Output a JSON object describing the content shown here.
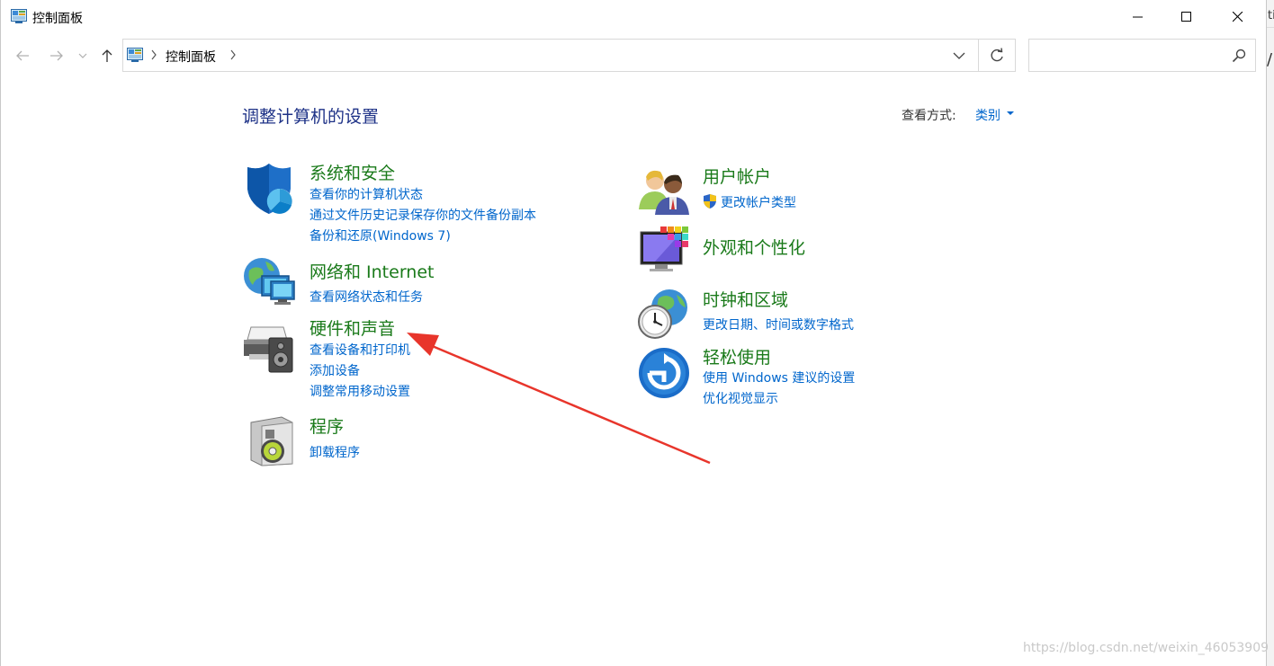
{
  "window": {
    "title": "控制面板"
  },
  "address_bar": {
    "breadcrumb": "控制面板",
    "separator": "›"
  },
  "search": {
    "value": "",
    "placeholder": ""
  },
  "main": {
    "heading": "调整计算机的设置",
    "view_by_label": "查看方式:",
    "view_by_value": "类别"
  },
  "categories": {
    "system_security": {
      "title": "系统和安全",
      "links": [
        "查看你的计算机状态",
        "通过文件历史记录保存你的文件备份副本",
        "备份和还原(Windows 7)"
      ]
    },
    "network": {
      "title": "网络和 Internet",
      "links": [
        "查看网络状态和任务"
      ]
    },
    "hardware": {
      "title": "硬件和声音",
      "links": [
        "查看设备和打印机",
        "添加设备",
        "调整常用移动设置"
      ]
    },
    "programs": {
      "title": "程序",
      "links": [
        "卸载程序"
      ]
    },
    "user_accounts": {
      "title": "用户帐户",
      "links": [
        "更改帐户类型"
      ]
    },
    "appearance": {
      "title": "外观和个性化",
      "links": []
    },
    "clock_region": {
      "title": "时钟和区域",
      "links": [
        "更改日期、时间或数字格式"
      ]
    },
    "ease_of_access": {
      "title": "轻松使用",
      "links": [
        "使用 Windows 建议的设置",
        "优化视觉显示"
      ]
    }
  },
  "annotation": {
    "arrow_color": "#e8352b"
  },
  "watermark": "https://blog.csdn.net/weixin_46053909",
  "colors": {
    "category_title": "#1a7a1a",
    "link": "#0066cc",
    "heading": "#1e3287"
  }
}
